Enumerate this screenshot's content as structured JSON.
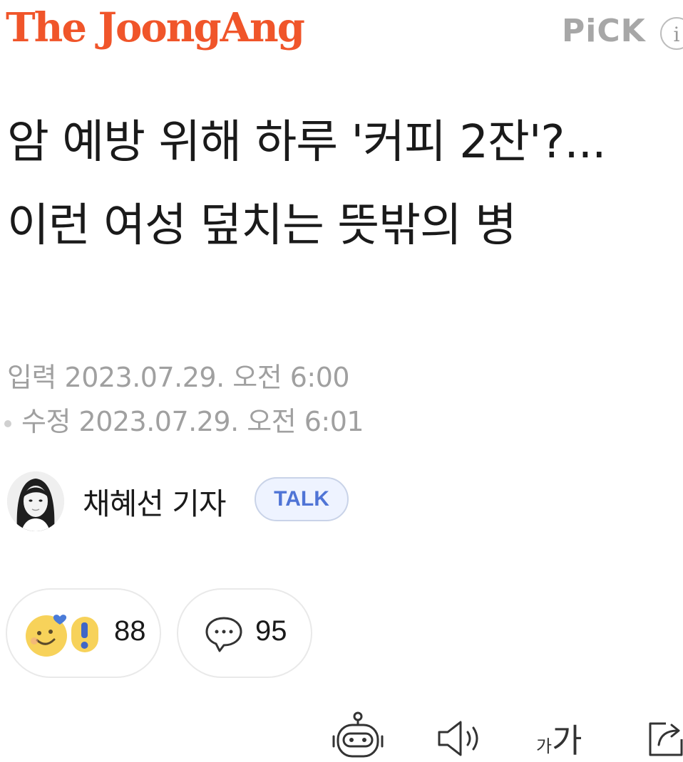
{
  "header": {
    "logo": "The JoongAng",
    "pick_label": "PiCK",
    "info_glyph": "i"
  },
  "article": {
    "headline": "암 예방 위해 하루 '커피 2잔'?...이런 여성 덮치는 뜻밖의 병",
    "input_label": "입력",
    "input_date": "2023.07.29. 오전 6:00",
    "modified_label": "수정",
    "modified_date": "2023.07.29. 오전 6:01"
  },
  "reporter": {
    "name": "채혜선 기자",
    "talk_label": "TALK"
  },
  "reactions": {
    "reaction_count": "88",
    "comment_count": "95"
  },
  "toolbar": {
    "font_size_small": "가",
    "font_size_large": "가",
    "icons": [
      "robot-summary-icon",
      "speaker-icon",
      "font-size-icon",
      "share-icon"
    ]
  },
  "colors": {
    "brand": "#f0552a",
    "talk": "#4f74d6",
    "meta": "#a0a0a0"
  }
}
